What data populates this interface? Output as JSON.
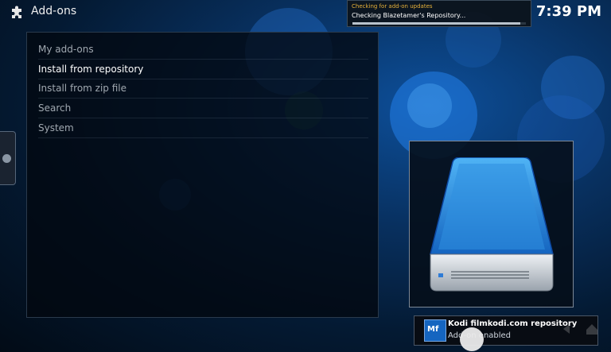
{
  "header": {
    "title": "Add-ons",
    "clock": "7:39 PM"
  },
  "notification": {
    "heading": "Checking for add-on updates",
    "text": "Checking Blazetamer's Repository...",
    "progress": 0.97
  },
  "menu": {
    "items": [
      {
        "label": "My add-ons",
        "active": false
      },
      {
        "label": "Install from repository",
        "active": true
      },
      {
        "label": "Install from zip file",
        "active": false
      },
      {
        "label": "Search",
        "active": false
      },
      {
        "label": "System",
        "active": false
      }
    ]
  },
  "toast": {
    "icon_text": "Mf",
    "title": "Kodi filmkodi.com repository",
    "message": "Add-on enabled"
  },
  "icons": {
    "header": "puzzle-piece-icon",
    "preview": "hard-drive-icon",
    "side": "side-menu-handle-icon"
  },
  "colors": {
    "accent": "#1e88e5",
    "notification_heading": "#e8b23a"
  }
}
